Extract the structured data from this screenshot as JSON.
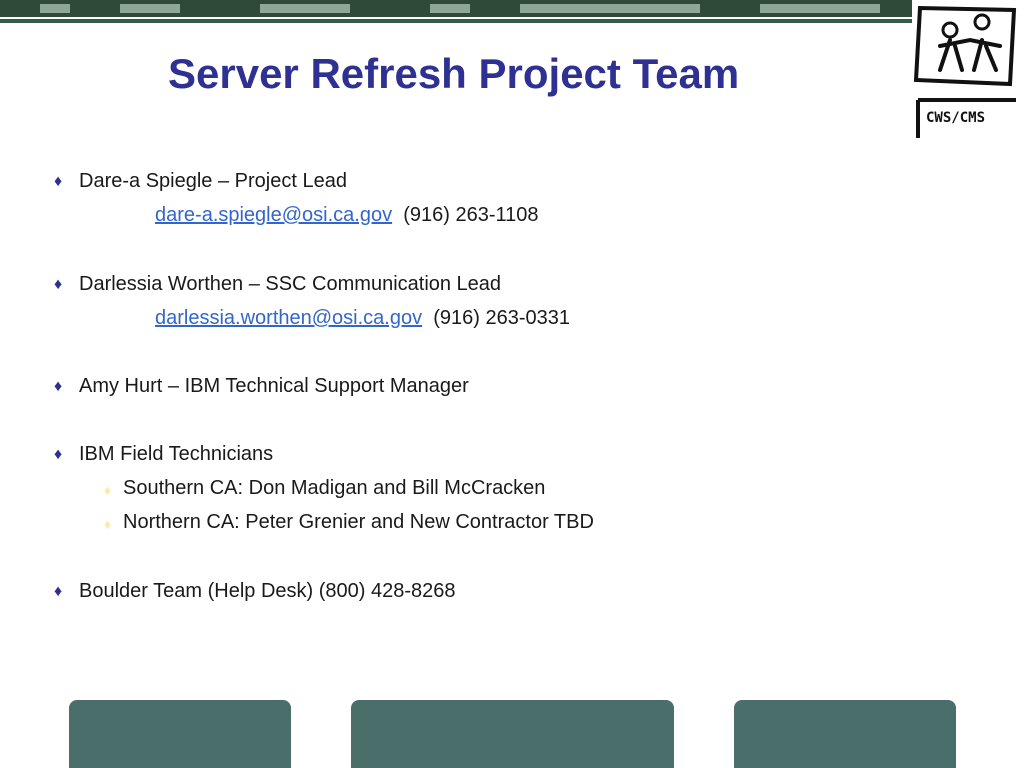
{
  "slide": {
    "title": "Server Refresh Project Team",
    "items": [
      {
        "text": "Dare-a Spiegle – Project Lead",
        "email": "dare-a.spiegle@osi.ca.gov",
        "phone": "(916) 263-1108"
      },
      {
        "text": "Darlessia Worthen – SSC Communication Lead",
        "email": "darlessia.worthen@osi.ca.gov",
        "phone": "(916) 263-0331"
      },
      {
        "text": "Amy Hurt – IBM Technical Support Manager"
      },
      {
        "text": "IBM Field Technicians",
        "subitems": [
          "Southern CA: Don Madigan and Bill McCracken",
          "Northern CA: Peter Grenier and New Contractor TBD"
        ]
      },
      {
        "text": "Boulder Team (Help Desk)  (800) 428-8268"
      }
    ],
    "bullet_glyph": "♦",
    "logo_text": "CWS/CMS"
  },
  "colors": {
    "title": "#2e3192",
    "link": "#3366cc",
    "footer_tab": "#4a6f6a",
    "banner": "#2f4a36"
  }
}
